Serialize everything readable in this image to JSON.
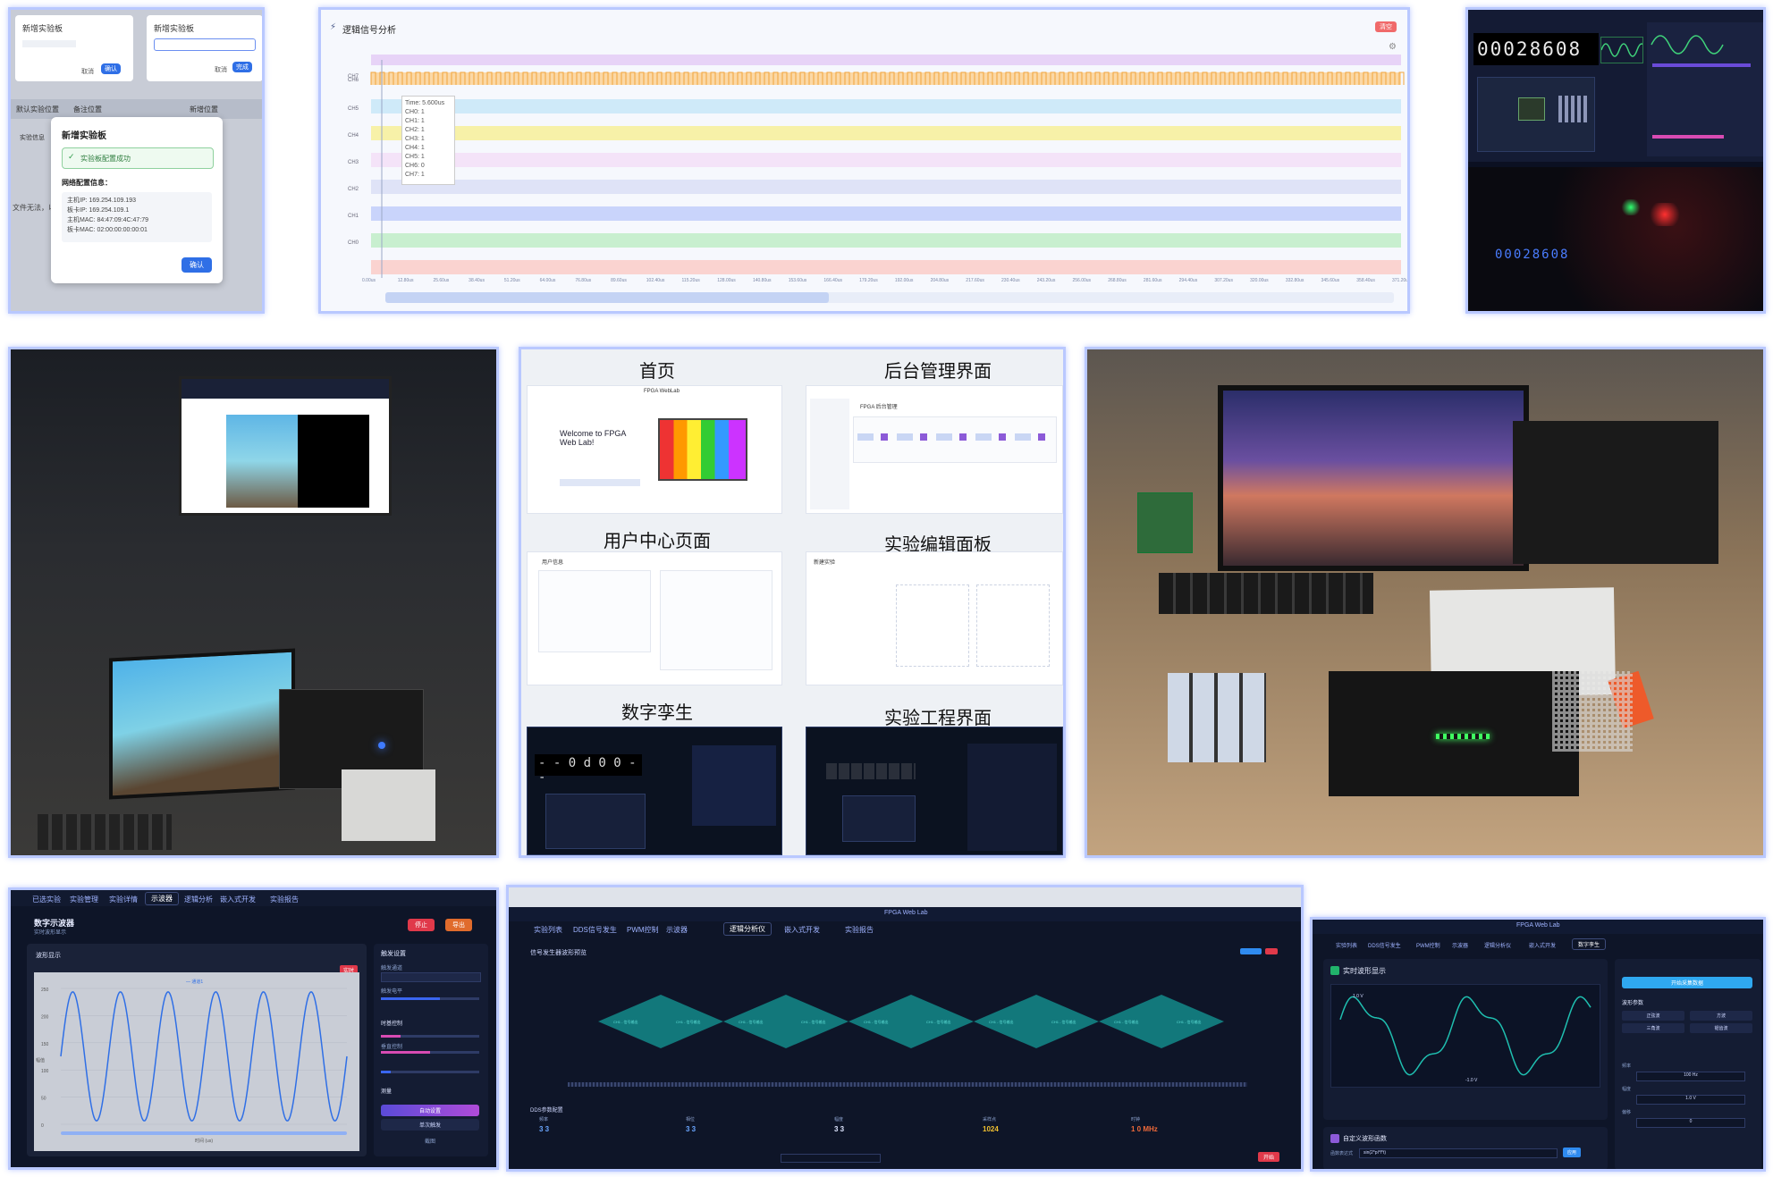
{
  "panel1": {
    "modal_title": "新增实验板",
    "success_text": "实验板配置成功",
    "info_label": "网络配置信息：",
    "lines": [
      "主机IP: 169.254.109.193",
      "板卡IP: 169.254.109.1",
      "主机MAC: 84:47:09:4C:47:79",
      "板卡MAC: 02:00:00:00:00:01"
    ],
    "confirm": "确认",
    "bg_left": "新增实验板",
    "bg_right": "新增实验板",
    "bg_btn1": "取消",
    "bg_btn2": "确认",
    "bg_btn3": "取消",
    "bg_btn4": "完成",
    "tab1": "默认实验位置",
    "tab2": "备注位置",
    "tab3": "新增位置",
    "row_text": "实验信息",
    "side_text": "文件无法，以"
  },
  "logic": {
    "title": "逻辑信号分析",
    "badge": "清空",
    "channels": [
      "CH7",
      "CH6",
      "CH5",
      "CH4",
      "CH3",
      "CH2",
      "CH1",
      "CH0"
    ],
    "tooltip": [
      "Time: 5.600us",
      "CH0: 1",
      "CH1: 1",
      "CH2: 1",
      "CH3: 1",
      "CH4: 1",
      "CH5: 1",
      "CH6: 0",
      "CH7: 1"
    ],
    "ticks": [
      "0.00us",
      "12.80us",
      "25.60us",
      "38.40us",
      "51.20us",
      "64.00us",
      "76.80us",
      "89.60us",
      "102.40us",
      "115.20us",
      "128.00us",
      "140.80us",
      "153.60us",
      "166.40us",
      "179.20us",
      "192.00us",
      "204.80us",
      "217.60us",
      "230.40us",
      "243.20us",
      "256.00us",
      "268.80us",
      "281.60us",
      "294.40us",
      "307.20us",
      "320.00us",
      "332.80us",
      "345.60us",
      "358.40us",
      "371.20us"
    ],
    "lane_colors": [
      "#cfeaf9",
      "#f7f1a8",
      "#f4e3f8",
      "#dfe3f7",
      "#c9d4fb",
      "#c8efcf",
      "#fad3d0"
    ]
  },
  "twin_top": {
    "counter": "00028608",
    "photo_counter": "00028608"
  },
  "collage": {
    "labels": [
      "首页",
      "后台管理界面",
      "用户中心页面",
      "实验编辑面板",
      "数字孪生",
      "实验工程界面"
    ],
    "welcome": "Welcome to FPGA Web Lab!",
    "app_name": "FPGA WebLab",
    "seg_text": "- - 0 d 0 0 - -",
    "user_title": "用户信息",
    "edit_title": "新建实验",
    "admin_title": "FPGA 后台管理"
  },
  "oscilloscope": {
    "tabs": [
      "已选实验",
      "实验管理",
      "实验详情",
      "示波器",
      "逻辑分析",
      "嵌入式开发",
      "实验报告"
    ],
    "title": "数字示波器",
    "subtitle": "实时波形显示",
    "panel_title": "波形显示",
    "run_btn": "停止",
    "export_btn": "导出",
    "right_title": "触发设置",
    "right_items": [
      "触发通道",
      "触发电平",
      "时基控制",
      "垂直控制",
      "测量"
    ],
    "btn1": "自动设置",
    "btn2": "单次触发",
    "btn3": "截图",
    "legend": "通道1",
    "xlabel": "时间 (us)",
    "ylabel": "幅值",
    "yticks": [
      "250",
      "200",
      "150",
      "100",
      "50",
      "0"
    ],
    "tag": "实时"
  },
  "siggen": {
    "app_title": "FPGA Web Lab",
    "tabs": [
      "实验列表",
      "DDS信号发生",
      "PWM控制",
      "示波器",
      "逻辑分析仪",
      "嵌入式开发",
      "实验报告"
    ],
    "section": "信号发生器波形预览",
    "section2": "DDS参数配置",
    "labels": [
      "频率",
      "相位",
      "幅度",
      "采样点",
      "时钟"
    ],
    "values": [
      "3 3",
      "3 3",
      "3 3",
      "1024",
      "1 0 MHz"
    ],
    "wave_labels": [
      "CH1 - 信号输出",
      "CH1 - 信号输出",
      "CH1 - 信号输出",
      "CH1 - 信号输出",
      "CH1 - 信号输出",
      "CH1 - 信号输出",
      "CH1 - 信号输出",
      "CH1 - 信号输出",
      "CH1 - 信号输出",
      "CH1 - 信号输出"
    ],
    "btn": "开始"
  },
  "realtime": {
    "app_title": "FPGA Web Lab",
    "tabs": [
      "实验列表",
      "DDS信号发生",
      "PWM控制",
      "示波器",
      "逻辑分析仪",
      "嵌入式开发",
      "数字孪生"
    ],
    "wave_title": "实时波形显示",
    "right_btn": "开始采集数据",
    "right_title": "波形参数",
    "grid_btns": [
      "正弦波",
      "方波",
      "三角波",
      "锯齿波"
    ],
    "section2": "自定义波形函数",
    "input_label": "函数表达式",
    "input_value": "sin(2*pi*f*t)",
    "apply": "应用",
    "params": [
      "频率",
      "幅度",
      "偏移"
    ],
    "param_values": [
      "100 Hz",
      "1.0 V",
      "0"
    ],
    "y_top": "1.0 V",
    "y_bottom": "-1.0 V"
  },
  "colors": {
    "accent": "#2f6fe6",
    "border": "#b9c8ff",
    "dark_bg": "#0f1629",
    "wave": "#1fbfb0"
  }
}
